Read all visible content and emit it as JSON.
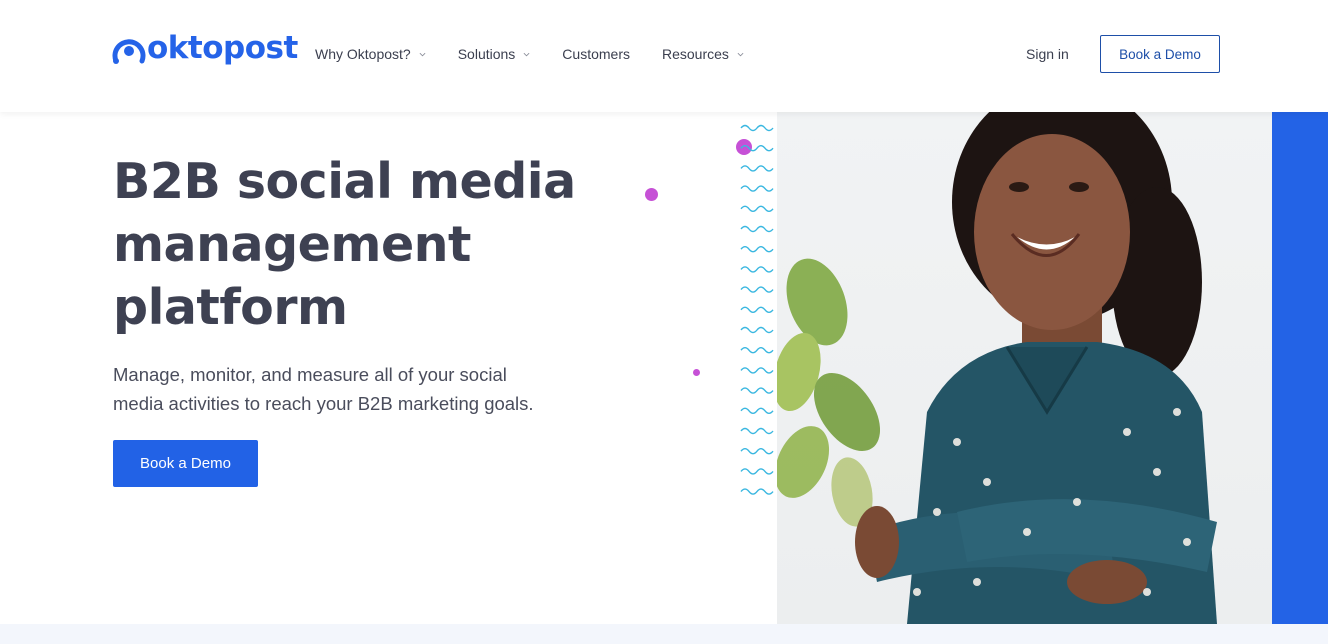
{
  "brand": {
    "name": "oktopost",
    "color": "#2563e8"
  },
  "nav": {
    "items": [
      {
        "label": "Why Oktopost?",
        "has_dropdown": true
      },
      {
        "label": "Solutions",
        "has_dropdown": true
      },
      {
        "label": "Customers",
        "has_dropdown": false
      },
      {
        "label": "Resources",
        "has_dropdown": true
      }
    ],
    "sign_in": "Sign in",
    "book_demo": "Book a Demo"
  },
  "hero": {
    "title_line1": "B2B social media",
    "title_line2": "management",
    "title_line3": "platform",
    "subtitle_line1": "Manage, monitor, and measure all of your social",
    "subtitle_line2": "media activities to reach your B2B marketing goals.",
    "cta": "Book a Demo"
  },
  "colors": {
    "primary": "#2262e6",
    "accent_dot": "#c651d6",
    "squiggle": "#3ab7e0",
    "heading": "#3e4152"
  },
  "icons": [
    "oktopost-logo-icon",
    "chevron-down-icon"
  ]
}
